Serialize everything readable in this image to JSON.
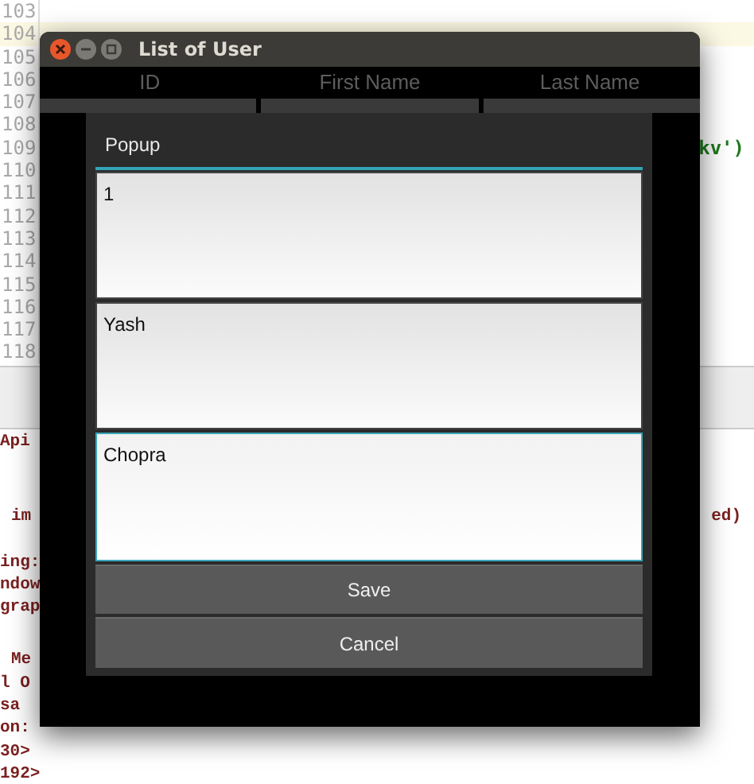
{
  "editor": {
    "lines": [
      {
        "number": "103",
        "current": false
      },
      {
        "number": "104",
        "current": true
      },
      {
        "number": "105",
        "current": false
      },
      {
        "number": "106",
        "current": false
      },
      {
        "number": "107",
        "current": false
      },
      {
        "number": "108",
        "current": false
      },
      {
        "number": "109",
        "current": false,
        "code": "kv')"
      },
      {
        "number": "110",
        "current": false
      },
      {
        "number": "111",
        "current": false
      },
      {
        "number": "112",
        "current": false
      },
      {
        "number": "113",
        "current": false
      },
      {
        "number": "114",
        "current": false
      },
      {
        "number": "115",
        "current": false
      },
      {
        "number": "116",
        "current": false
      },
      {
        "number": "117",
        "current": false
      },
      {
        "number": "118",
        "current": false
      }
    ]
  },
  "console": {
    "blocks": [
      [
        {
          "text": "Api",
          "indent": false
        }
      ],
      [
        {
          "text": "im",
          "indent": true,
          "right": "ed)"
        }
      ],
      [
        {
          "text": "ing:",
          "indent": false
        },
        {
          "text": "ndow",
          "indent": false
        },
        {
          "text": "grap",
          "indent": false
        }
      ],
      [
        {
          "text": "Me",
          "indent": true
        },
        {
          "text": "l O",
          "indent": false
        },
        {
          "text": "sa",
          "indent": false
        },
        {
          "text": "on:",
          "indent": false
        },
        {
          "text": "30>",
          "indent": false
        },
        {
          "text": "192>",
          "indent": false
        }
      ]
    ]
  },
  "window": {
    "title": "List of User",
    "table": {
      "columns": [
        "ID",
        "First Name",
        "Last Name"
      ]
    },
    "popup": {
      "title": "Popup",
      "fields": [
        {
          "value": "1",
          "focused": false
        },
        {
          "value": "Yash",
          "focused": false
        },
        {
          "value": "Chopra",
          "focused": true
        }
      ],
      "buttons": [
        "Save",
        "Cancel"
      ]
    }
  }
}
